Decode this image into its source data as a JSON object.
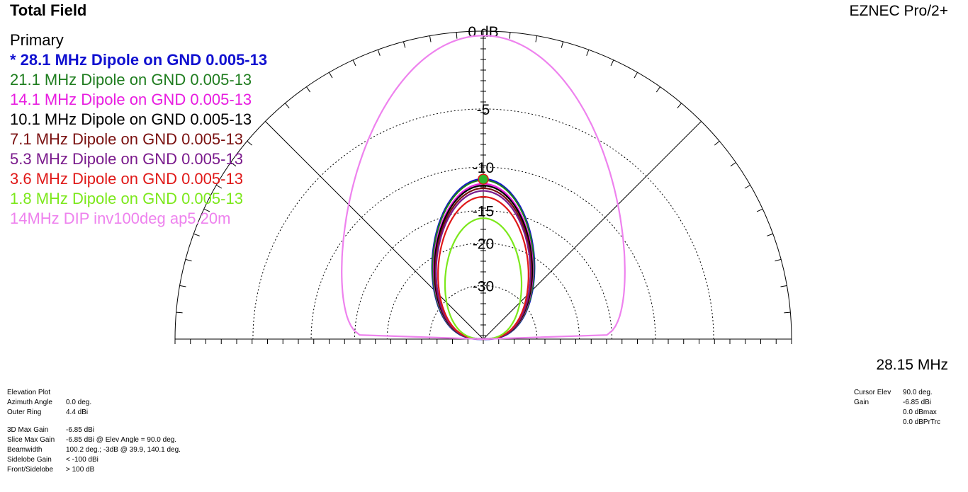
{
  "header": {
    "title": "Total Field",
    "app_name": "EZNEC Pro/2+"
  },
  "legend": {
    "heading": "Primary",
    "items": [
      {
        "label": "* 28.1 MHz Dipole on GND 0.005-13",
        "color": "#1010D0",
        "selected": true
      },
      {
        "label": "21.1 MHz Dipole on GND 0.005-13",
        "color": "#1E7E1E"
      },
      {
        "label": "14.1 MHz Dipole on GND 0.005-13",
        "color": "#E81CE0"
      },
      {
        "label": "10.1 MHz Dipole on GND 0.005-13",
        "color": "#000000"
      },
      {
        "label": "7.1 MHz Dipole on GND 0.005-13",
        "color": "#7A1010"
      },
      {
        "label": "5.3 MHz Dipole on GND 0.005-13",
        "color": "#7A1A8C"
      },
      {
        "label": "3.6 MHz Dipole on GND 0.005-13",
        "color": "#E01818"
      },
      {
        "label": "1.8 MHz Dipole on GND 0.005-13",
        "color": "#7CE81C"
      },
      {
        "label": "14MHz DIP inv100deg ap5.20m",
        "color": "#EE82EE"
      }
    ]
  },
  "frequency": "28.15 MHz",
  "info": [
    {
      "label": "Elevation Plot",
      "value": ""
    },
    {
      "label": "Azimuth Angle",
      "value": "0.0 deg."
    },
    {
      "label": "Outer Ring",
      "value": "4.4 dBi"
    },
    {
      "label": "3D Max Gain",
      "value": "-6.85 dBi"
    },
    {
      "label": "Slice Max Gain",
      "value": "-6.85 dBi @ Elev Angle = 90.0 deg."
    },
    {
      "label": "Beamwidth",
      "value": "100.2 deg.; -3dB @ 39.9, 140.1 deg."
    },
    {
      "label": "Sidelobe Gain",
      "value": "< -100 dBi"
    },
    {
      "label": "Front/Sidelobe",
      "value": "> 100 dB"
    }
  ],
  "cursor": [
    {
      "label": "Cursor Elev",
      "value": "90.0 deg."
    },
    {
      "label": "Gain",
      "value": "-6.85 dBi"
    },
    {
      "label": "",
      "value": "0.0 dBmax"
    },
    {
      "label": "",
      "value": "0.0 dBPrTrc"
    }
  ],
  "chart_data": {
    "type": "polar-elevation",
    "title": "Total Field",
    "rings_db": [
      0,
      -5,
      -10,
      -15,
      -20,
      -30
    ],
    "ring_labels": [
      "0 dB",
      "-5",
      "-10",
      "-15",
      "-20",
      "-30"
    ],
    "outer_ring_dbi": 4.4,
    "elevation_range_deg": [
      0,
      180
    ],
    "grid": true,
    "series": [
      {
        "name": "28.1 MHz Dipole on GND 0.005-13",
        "color": "#1010D0",
        "max_rel_db": 0,
        "beamwidth_deg": 100,
        "shape_exp": 1.0
      },
      {
        "name": "21.1 MHz Dipole on GND 0.005-13",
        "color": "#1E7E1E",
        "max_rel_db": -0.1,
        "beamwidth_deg": 100,
        "shape_exp": 1.0
      },
      {
        "name": "14.1 MHz Dipole on GND 0.005-13",
        "color": "#E81CE0",
        "max_rel_db": -0.5,
        "beamwidth_deg": 100,
        "shape_exp": 1.0
      },
      {
        "name": "10.1 MHz Dipole on GND 0.005-13",
        "color": "#000000",
        "max_rel_db": -0.7,
        "beamwidth_deg": 100,
        "shape_exp": 1.0
      },
      {
        "name": "7.1 MHz Dipole on GND 0.005-13",
        "color": "#7A1010",
        "max_rel_db": -1.0,
        "beamwidth_deg": 100,
        "shape_exp": 1.0
      },
      {
        "name": "5.3 MHz Dipole on GND 0.005-13",
        "color": "#7A1A8C",
        "max_rel_db": -1.3,
        "beamwidth_deg": 100,
        "shape_exp": 1.0
      },
      {
        "name": "3.6 MHz Dipole on GND 0.005-13",
        "color": "#E01818",
        "max_rel_db": -2.0,
        "beamwidth_deg": 100,
        "shape_exp": 1.0
      },
      {
        "name": "1.8 MHz Dipole on GND 0.005-13",
        "color": "#7CE81C",
        "max_rel_db": -4.8,
        "beamwidth_deg": 100,
        "shape_exp": 1.0
      },
      {
        "name": "14MHz DIP inv100deg ap5.20m",
        "color": "#EE82EE",
        "max_rel_db": 11.0,
        "beamwidth_deg": 100,
        "shape_exp": 0.12
      }
    ],
    "cursor_elevation_deg": 90
  }
}
